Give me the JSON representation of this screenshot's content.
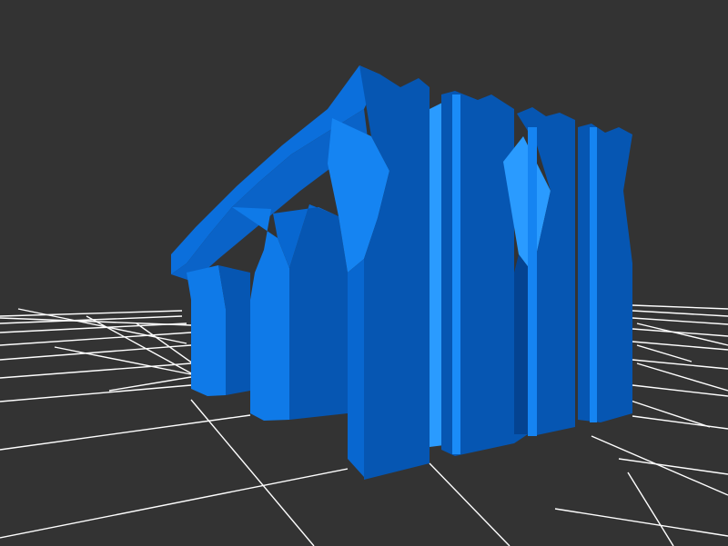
{
  "scene": {
    "background_color": "#333333",
    "grid_color": "#ffffff",
    "model_colors": {
      "light": "#2a9bff",
      "base": "#0f7ae8",
      "mid": "#0867d0",
      "dark": "#0656b2",
      "deep": "#044391"
    }
  }
}
